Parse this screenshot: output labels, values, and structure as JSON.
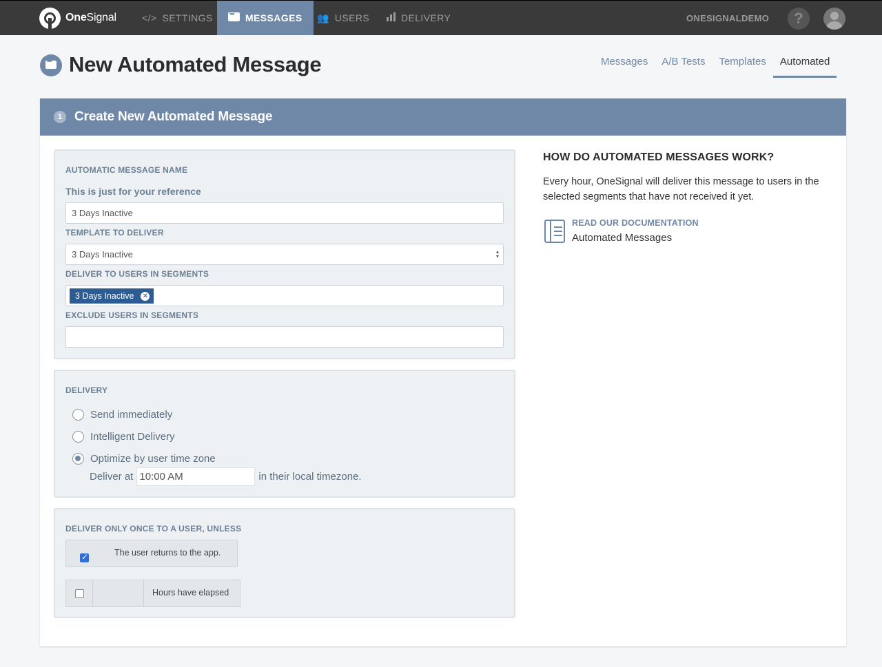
{
  "app": {
    "brand_bold": "One",
    "brand_rest": "Signal",
    "account": "ONESIGNALDEMO",
    "help": "?"
  },
  "nav": {
    "settings": "SETTINGS",
    "messages": "MESSAGES",
    "users": "USERS",
    "delivery": "DELIVERY"
  },
  "page": {
    "title": "New Automated Message",
    "tabs": [
      "Messages",
      "A/B Tests",
      "Templates",
      "Automated"
    ],
    "active_tab": "Automated"
  },
  "card": {
    "step": "1",
    "title": "Create New Automated Message"
  },
  "form": {
    "name_label": "AUTOMATIC MESSAGE NAME",
    "name_hint": "This is just for your reference",
    "name_value": "3 Days Inactive",
    "template_label": "TEMPLATE TO DELIVER",
    "template_value": "3 Days Inactive",
    "segments_label": "DELIVER TO USERS IN SEGMENTS",
    "segment_tag": "3 Days Inactive",
    "exclude_label": "EXCLUDE USERS IN SEGMENTS",
    "exclude_value": ""
  },
  "delivery": {
    "label": "DELIVERY",
    "options": [
      "Send immediately",
      "Intelligent Delivery",
      "Optimize by user time zone"
    ],
    "selected": "Optimize by user time zone",
    "deliver_at_prefix": "Deliver at",
    "deliver_at_value": "10:00 AM",
    "deliver_at_suffix": "in their local timezone."
  },
  "once": {
    "label": "DELIVER ONLY ONCE TO A USER, UNLESS",
    "returns_text": "The user returns to the app.",
    "returns_checked": true,
    "hours_text": "Hours have elapsed",
    "hours_checked": false,
    "hours_value": ""
  },
  "side": {
    "title": "HOW DO AUTOMATED MESSAGES WORK?",
    "description": "Every hour, OneSignal will deliver this message to users in the selected segments that have not received it yet.",
    "doc_link": "READ OUR DOCUMENTATION",
    "doc_sub": "Automated Messages"
  },
  "colors": {
    "nav_bg": "#3a3a3a",
    "accent": "#6f88a8",
    "tag": "#2d5c94"
  }
}
